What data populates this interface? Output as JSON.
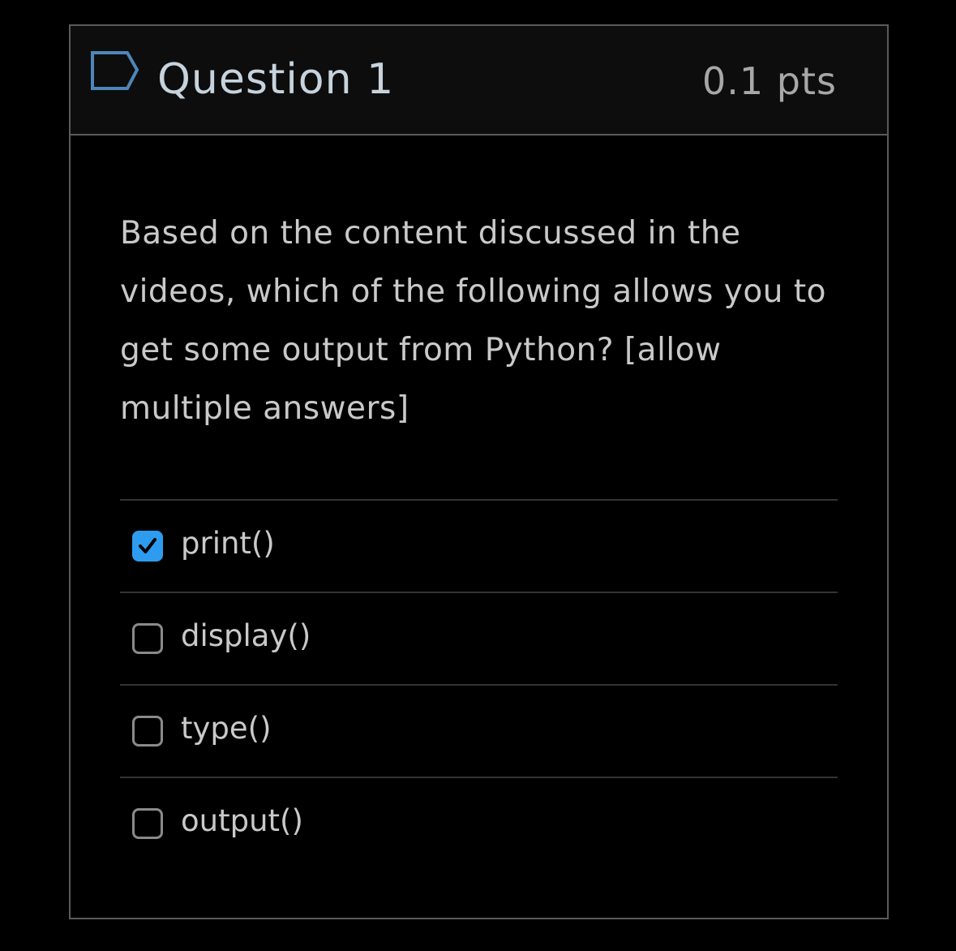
{
  "question": {
    "title": "Question 1",
    "points": "0.1 pts",
    "text": "Based on the content discussed in the videos, which of the following allows you to get some output from Python? [allow multiple answers]",
    "flag_icon": "flag-outline-icon"
  },
  "answers": [
    {
      "label": "print()",
      "checked": true
    },
    {
      "label": "display()",
      "checked": false
    },
    {
      "label": "type()",
      "checked": false
    },
    {
      "label": "output()",
      "checked": false
    }
  ],
  "colors": {
    "accent": "#2d9cf0",
    "background": "#000000",
    "header_background": "#0d0d0e",
    "border": "#5a5a5a",
    "text": "#c9c9c9",
    "title_text": "#c7d3dc"
  }
}
